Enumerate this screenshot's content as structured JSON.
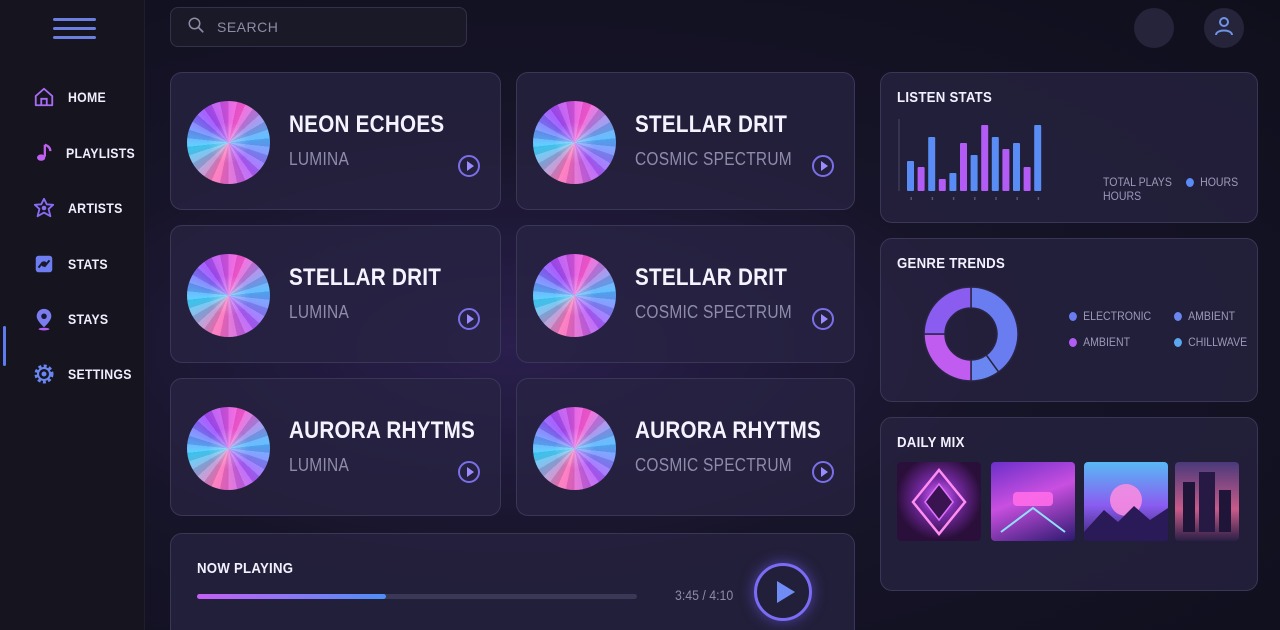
{
  "sidebar": {
    "items": [
      {
        "label": "HOME",
        "icon": "home-icon"
      },
      {
        "label": "PLAYLISTS",
        "icon": "music-note-icon"
      },
      {
        "label": "ARTISTS",
        "icon": "star-icon"
      },
      {
        "label": "STATS",
        "icon": "stats-icon"
      },
      {
        "label": "STAYS",
        "icon": "map-pin-icon"
      },
      {
        "label": "SETTINGS",
        "icon": "gear-icon"
      }
    ],
    "active_index": 4
  },
  "search": {
    "placeholder": "SEARCH",
    "icon": "search-icon"
  },
  "songs": [
    {
      "title": "NEON ECHOES",
      "artist": "LUMINA"
    },
    {
      "title": "STELLAR DRIT",
      "artist": "COSMIC SPECTRUM"
    },
    {
      "title": "STELLAR DRIT",
      "artist": "LUMINA"
    },
    {
      "title": "STELLAR DRIT",
      "artist": "COSMIC SPECTRUM"
    },
    {
      "title": "AURORA RHYTMS",
      "artist": "LUMINA"
    },
    {
      "title": "AURORA RHYTMS",
      "artist": "COSMIC SPECTRUM"
    }
  ],
  "now_playing": {
    "title": "NOW PLAYING",
    "time": "3:45 / 4:10",
    "progress_fraction": 0.43
  },
  "listen_stats": {
    "title": "LISTEN STATS",
    "legend_left_line1": "TOTAL PLAYS",
    "legend_left_line2": "HOURS",
    "legend_right": "HOURS"
  },
  "genre_trends": {
    "title": "GENRE TRENDS",
    "legend": [
      "ELECTRONIC",
      "AMBIENT",
      "AMBIENT",
      "CHILLWAVE"
    ]
  },
  "daily_mix": {
    "title": "DAILY MIX"
  },
  "colors": {
    "accent_blue": "#5a8cf5",
    "accent_purple": "#b25cf5",
    "accent_pink": "#e05cf0"
  },
  "chart_data": [
    {
      "type": "bar",
      "series": [
        {
          "name": "TOTAL PLAYS",
          "color": "#5a8cf5",
          "values": [
            5,
            0,
            9,
            0,
            3,
            0,
            6,
            0,
            9,
            0,
            8,
            0,
            11
          ]
        },
        {
          "name": "HOURS",
          "color": "#b25cf5",
          "values": [
            0,
            4,
            0,
            2,
            0,
            8,
            0,
            11,
            0,
            7,
            0,
            4,
            0
          ]
        }
      ],
      "combined_values": [
        5,
        4,
        9,
        2,
        3,
        8,
        6,
        11,
        9,
        7,
        8,
        4,
        11
      ],
      "combined_colors": [
        "#5a8cf5",
        "#b25cf5",
        "#5a8cf5",
        "#b25cf5",
        "#5a8cf5",
        "#b25cf5",
        "#5a8cf5",
        "#b25cf5",
        "#5a8cf5",
        "#b25cf5",
        "#5a8cf5",
        "#b25cf5",
        "#5a8cf5"
      ],
      "ylim": [
        0,
        12
      ]
    },
    {
      "type": "pie",
      "donut": true,
      "labels": [
        "ELECTRONIC",
        "AMBIENT",
        "AMBIENT",
        "CHILLWAVE"
      ],
      "values": [
        40,
        10,
        25,
        25
      ],
      "colors": [
        "#6a7df0",
        "#6a86f0",
        "#c05cf0",
        "#8b5cf0"
      ]
    }
  ]
}
